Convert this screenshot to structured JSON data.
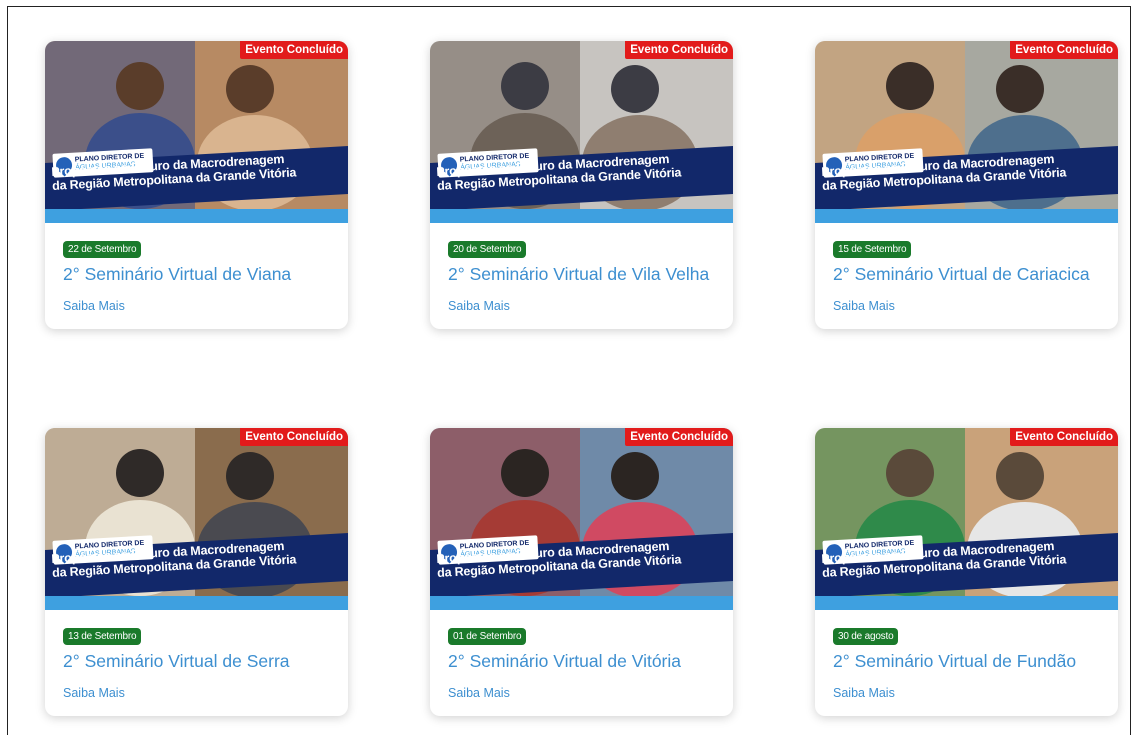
{
  "status_label": "Evento Concluído",
  "banner_line1": "Propostas ao Futuro da Macrodrenagem",
  "banner_line2": "da Região Metropolitana da Grande Vitória",
  "logo_line1": "PLANO DIRETOR DE",
  "logo_line2": "ÁGUAS URBANAS",
  "cards": [
    {
      "date": "22 de Setembro",
      "title": "2° Seminário Virtual de Viana",
      "more": "Saiba Mais",
      "photo_colors": [
        "#b78a63",
        "#3b4f8a",
        "#d9b48f",
        "#5a3d2a"
      ]
    },
    {
      "date": "20 de Setembro",
      "title": "2° Seminário Virtual de Vila Velha",
      "more": "Saiba Mais",
      "photo_colors": [
        "#c7c4c0",
        "#6d6258",
        "#8f7e70",
        "#3c3c44"
      ]
    },
    {
      "date": "15 de Setembro",
      "title": "2° Seminário Virtual de Cariacica",
      "more": "Saiba Mais",
      "photo_colors": [
        "#a7a8a0",
        "#d9a06a",
        "#4e6f8d",
        "#3a2e28"
      ]
    },
    {
      "date": "13 de Setembro",
      "title": "2° Seminário Virtual de Serra",
      "more": "Saiba Mais",
      "photo_colors": [
        "#8a6c4d",
        "#e9e2d2",
        "#4a4a50",
        "#2f2a28"
      ]
    },
    {
      "date": "01 de Setembro",
      "title": "2° Seminário Virtual de Vitória",
      "more": "Saiba Mais",
      "photo_colors": [
        "#6f8aa8",
        "#a53b35",
        "#d04a62",
        "#2b2522"
      ]
    },
    {
      "date": "30 de agosto",
      "title": "2° Seminário Virtual de Fundão",
      "more": "Saiba Mais",
      "photo_colors": [
        "#c9a27a",
        "#2f8a4a",
        "#e6e6e6",
        "#5a4a3a"
      ]
    }
  ]
}
